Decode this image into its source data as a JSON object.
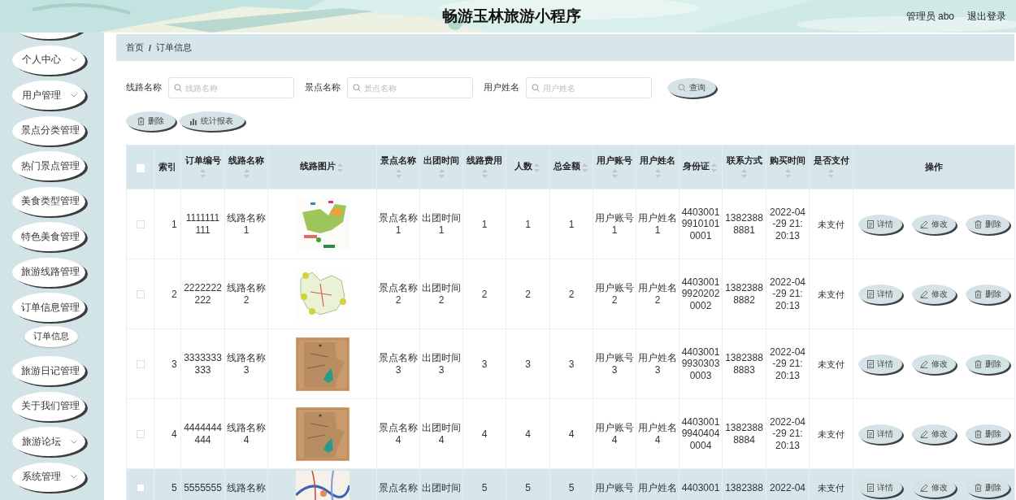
{
  "header": {
    "title": "畅游玉林旅游小程序",
    "user": "管理员 abo",
    "logout": "退出登录"
  },
  "sidebar": {
    "items": [
      {
        "label": "个人中心",
        "kind": "dropdown"
      },
      {
        "label": "用户管理",
        "kind": "dropdown"
      },
      {
        "label": "景点分类管理",
        "kind": "link"
      },
      {
        "label": "热门景点管理",
        "kind": "link"
      },
      {
        "label": "美食类型管理",
        "kind": "link"
      },
      {
        "label": "特色美食管理",
        "kind": "link"
      },
      {
        "label": "旅游线路管理",
        "kind": "link"
      },
      {
        "label": "订单信息管理",
        "kind": "link",
        "children": [
          {
            "label": "订单信息",
            "selected": true
          }
        ]
      },
      {
        "label": "旅游日记管理",
        "kind": "link"
      },
      {
        "label": "关于我们管理",
        "kind": "link"
      },
      {
        "label": "旅游论坛",
        "kind": "dropdown"
      },
      {
        "label": "系统管理",
        "kind": "dropdown"
      }
    ]
  },
  "breadcrumb": {
    "items": [
      "首页",
      "订单信息"
    ],
    "separator": "/"
  },
  "search": {
    "fields": [
      {
        "label": "线路名称",
        "placeholder": "线路名称"
      },
      {
        "label": "景点名称",
        "placeholder": "景点名称"
      },
      {
        "label": "用户姓名",
        "placeholder": "用户姓名"
      }
    ],
    "button": "查询"
  },
  "actions": [
    {
      "label": "删除",
      "kind": "delete"
    },
    {
      "label": "统计报表",
      "kind": "report"
    }
  ],
  "table": {
    "header_checked": false,
    "columns": [
      {
        "label": "索引",
        "sortable": false
      },
      {
        "label": "订单编号",
        "sortable": true
      },
      {
        "label": "线路名称",
        "sortable": true
      },
      {
        "label": "线路图片",
        "sortable": true
      },
      {
        "label": "景点名称",
        "sortable": true
      },
      {
        "label": "出团时间",
        "sortable": true
      },
      {
        "label": "线路费用",
        "sortable": true
      },
      {
        "label": "人数",
        "sortable": true
      },
      {
        "label": "总金额",
        "sortable": true
      },
      {
        "label": "用户账号",
        "sortable": true
      },
      {
        "label": "用户姓名",
        "sortable": true
      },
      {
        "label": "身份证",
        "sortable": true
      },
      {
        "label": "联系方式",
        "sortable": true
      },
      {
        "label": "购买时间",
        "sortable": true
      },
      {
        "label": "是否支付",
        "sortable": true
      },
      {
        "label": "操作",
        "sortable": false
      }
    ],
    "rows": [
      {
        "checked": false,
        "highlighted": false,
        "cells": [
          "1",
          "1111111111",
          "线路名称1",
          {
            "kind": "picture"
          },
          "景点名称1",
          "出团时间1",
          "1",
          "1",
          "1",
          "用户账号1",
          "用户姓名1",
          "440300199101010001",
          "13823888881",
          "2022-04-29 21:20:13",
          "未支付"
        ],
        "buttons": [
          {
            "label": "详情",
            "kind": "detail"
          },
          {
            "label": "修改",
            "kind": "edit"
          },
          {
            "label": "删除",
            "kind": "delete"
          }
        ]
      },
      {
        "checked": false,
        "highlighted": false,
        "cells": [
          "2",
          "2222222222",
          "线路名称2",
          {
            "kind": "picture"
          },
          "景点名称2",
          "出团时间2",
          "2",
          "2",
          "2",
          "用户账号2",
          "用户姓名2",
          "440300199202020002",
          "13823888882",
          "2022-04-29 21:20:13",
          "未支付"
        ],
        "buttons": [
          {
            "label": "详情",
            "kind": "detail"
          },
          {
            "label": "修改",
            "kind": "edit"
          },
          {
            "label": "删除",
            "kind": "delete"
          }
        ]
      },
      {
        "checked": false,
        "highlighted": false,
        "cells": [
          "3",
          "3333333333",
          "线路名称3",
          {
            "kind": "picture"
          },
          "景点名称3",
          "出团时间3",
          "3",
          "3",
          "3",
          "用户账号3",
          "用户姓名3",
          "440300199303030003",
          "13823888883",
          "2022-04-29 21:20:13",
          "未支付"
        ],
        "buttons": [
          {
            "label": "详情",
            "kind": "detail"
          },
          {
            "label": "修改",
            "kind": "edit"
          },
          {
            "label": "删除",
            "kind": "delete"
          }
        ]
      },
      {
        "checked": false,
        "highlighted": false,
        "cells": [
          "4",
          "4444444444",
          "线路名称4",
          {
            "kind": "picture"
          },
          "景点名称4",
          "出团时间4",
          "4",
          "4",
          "4",
          "用户账号4",
          "用户姓名4",
          "440300199404040004",
          "13823888884",
          "2022-04-29 21:20:13",
          "未支付"
        ],
        "buttons": [
          {
            "label": "详情",
            "kind": "detail"
          },
          {
            "label": "修改",
            "kind": "edit"
          },
          {
            "label": "删除",
            "kind": "delete"
          }
        ]
      },
      {
        "checked": false,
        "highlighted": true,
        "cells": [
          "5",
          "5555555",
          "线路名称",
          {
            "kind": "picture"
          },
          "景点名称",
          "出团时间",
          "5",
          "5",
          "5",
          "用户账号",
          "用户姓名",
          "4403001",
          "1382388",
          "2022-04",
          "未支付"
        ],
        "buttons": [
          {
            "label": "详情",
            "kind": "detail"
          },
          {
            "label": "修改",
            "kind": "edit"
          },
          {
            "label": "删除",
            "kind": "delete"
          }
        ]
      }
    ]
  }
}
